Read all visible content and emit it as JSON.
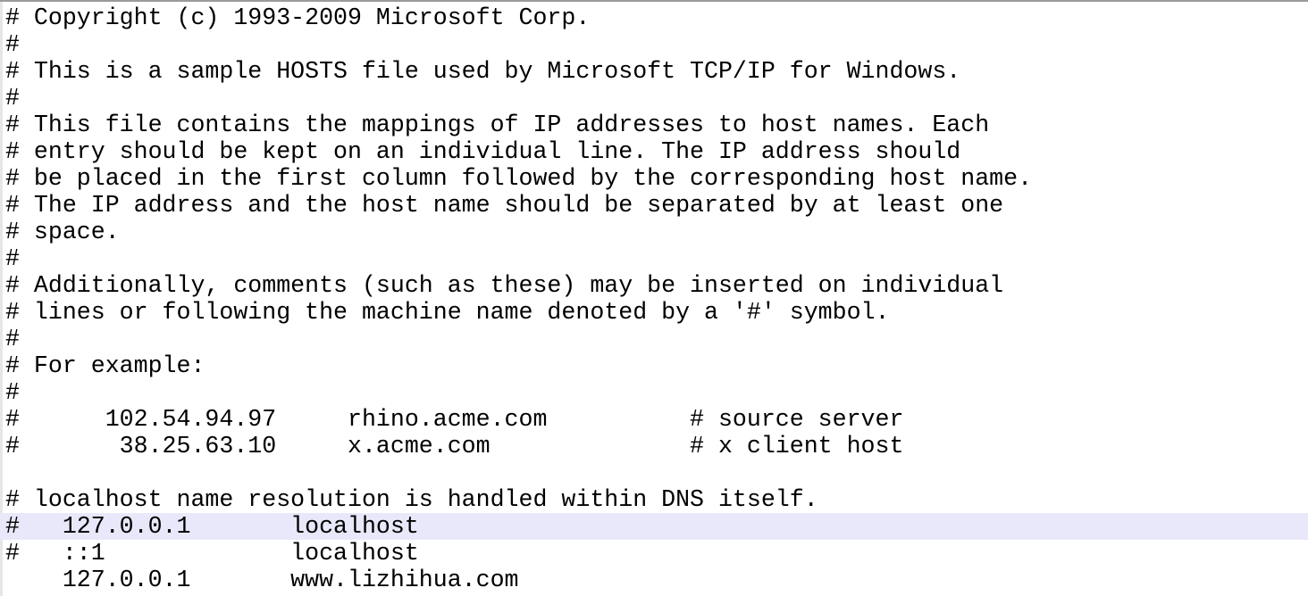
{
  "editor": {
    "current_line_index": 19,
    "current_line_color": "#e8e8fa",
    "lines": [
      "# Copyright (c) 1993-2009 Microsoft Corp.",
      "#",
      "# This is a sample HOSTS file used by Microsoft TCP/IP for Windows.",
      "#",
      "# This file contains the mappings of IP addresses to host names. Each",
      "# entry should be kept on an individual line. The IP address should",
      "# be placed in the first column followed by the corresponding host name.",
      "# The IP address and the host name should be separated by at least one",
      "# space.",
      "#",
      "# Additionally, comments (such as these) may be inserted on individual",
      "# lines or following the machine name denoted by a '#' symbol.",
      "#",
      "# For example:",
      "#",
      "#      102.54.94.97     rhino.acme.com          # source server",
      "#       38.25.63.10     x.acme.com              # x client host",
      "",
      "# localhost name resolution is handled within DNS itself.",
      "#   127.0.0.1       localhost",
      "#   ::1             localhost",
      "    127.0.0.1       www.lizhihua.com"
    ]
  }
}
